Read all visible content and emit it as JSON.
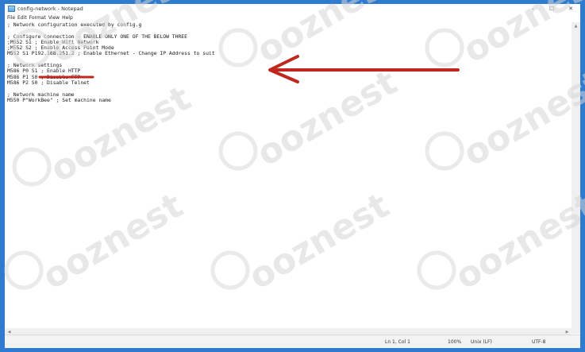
{
  "window": {
    "title": "config-network - Notepad"
  },
  "window_controls": {
    "minimize": "–",
    "maximize": "☐",
    "close": "✕"
  },
  "menu": [
    "File",
    "Edit",
    "Format",
    "View",
    "Help"
  ],
  "content_lines": [
    "; Network configuration executed by config.g",
    "",
    "; Configure Connection - ENABLE ONLY ONE OF THE BELOW THREE",
    ";M552 S1 ; Enable Wifi Network",
    ";M552 S2 ; Enable Access Point Mode",
    "M552 S1 P192.168.251.2 ; Enable Ethernet - Change IP Address to suit",
    "",
    "; Network settings",
    "M586 P0 S1 ; Enable HTTP",
    "M586 P1 S0 ; Disable FTP",
    "M586 P2 S0 ; Disable Telnet",
    "",
    "; Network machine name",
    "M550 P\"WorkBee\" ; Set machine name"
  ],
  "status": {
    "position": "Ln 1, Col 1",
    "zoom": "100%",
    "line_ending": "Unix (LF)",
    "encoding": "UTF-8"
  },
  "watermark_text": "ooznest",
  "colors": {
    "background_frame": "#2f7bd0",
    "annotation_red": "#c0281e",
    "watermark": "#d9d9d9"
  }
}
